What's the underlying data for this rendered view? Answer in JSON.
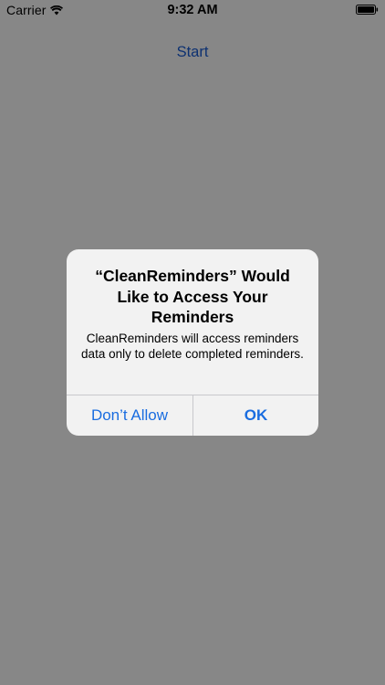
{
  "status_bar": {
    "carrier": "Carrier",
    "time": "9:32 AM",
    "wifi_icon": "wifi-icon",
    "battery_icon": "battery-icon"
  },
  "main": {
    "start_label": "Start"
  },
  "alert": {
    "title": "“CleanReminders” Would Like to Access Your Reminders",
    "message": "CleanReminders will access reminders data only to delete completed reminders.",
    "deny_label": "Don’t Allow",
    "ok_label": "OK"
  },
  "colors": {
    "link_blue": "#1a6de0",
    "overlay": "#8a8a8a"
  }
}
